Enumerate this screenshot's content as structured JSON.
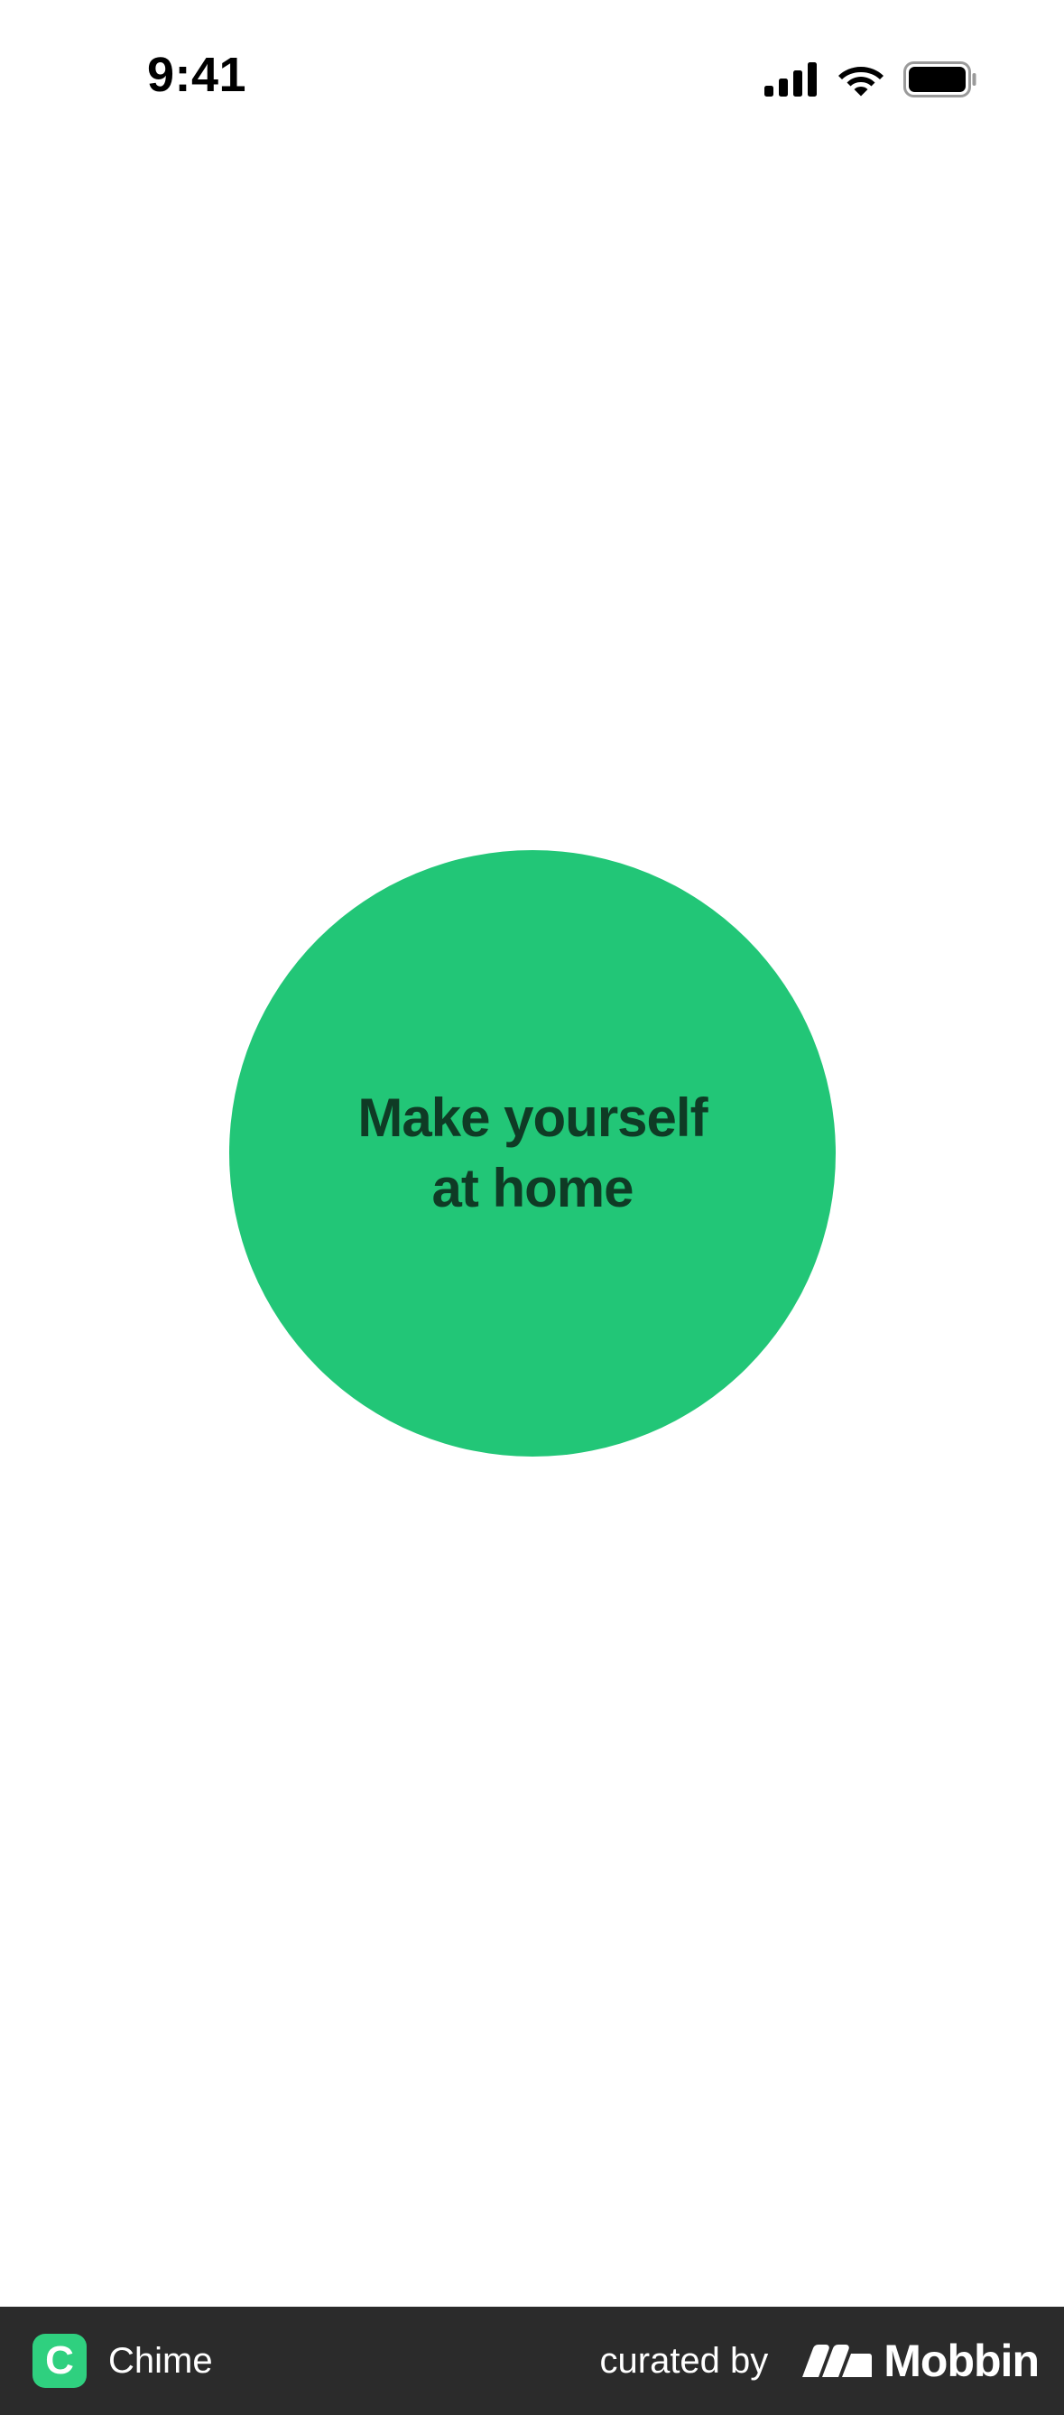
{
  "status_bar": {
    "time": "9:41",
    "icons": [
      "signal-icon",
      "wifi-icon",
      "battery-icon"
    ]
  },
  "hero": {
    "line1": "Make yourself",
    "line2": "at home",
    "circle_color": "#22c677",
    "text_color": "#0f3b25"
  },
  "footer": {
    "app_icon_letter": "C",
    "app_name": "Chime",
    "curated_label": "curated by",
    "brand_name": "Mobbin",
    "background": "#2b2b2b",
    "app_icon_color": "#2fd07f"
  }
}
